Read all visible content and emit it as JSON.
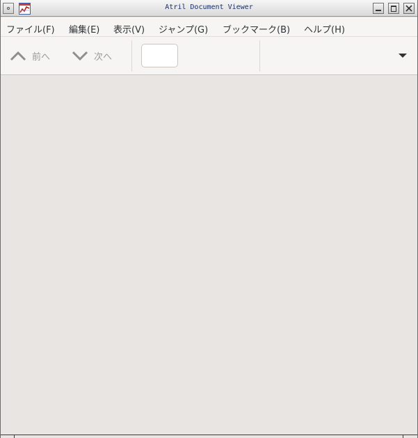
{
  "window": {
    "title": "Atril Document Viewer"
  },
  "menubar": {
    "items": [
      {
        "label": "ファイル(F)"
      },
      {
        "label": "編集(E)"
      },
      {
        "label": "表示(V)"
      },
      {
        "label": "ジャンプ(G)"
      },
      {
        "label": "ブックマーク(B)"
      },
      {
        "label": "ヘルプ(H)"
      }
    ]
  },
  "toolbar": {
    "prev_label": "前へ",
    "next_label": "次へ",
    "page_entry_value": ""
  },
  "colors": {
    "title_text": "#1c2c63",
    "menubar_bg": "#f6f5f4",
    "content_bg": "#e8e5e2"
  }
}
